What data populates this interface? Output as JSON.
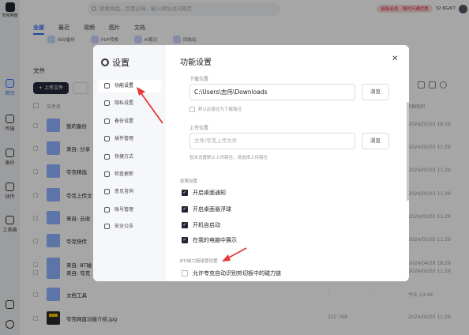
{
  "app": {
    "logo_text": "夸克网盘"
  },
  "search": {
    "placeholder": "搜索网盘、百度全网，输入网址访问网页"
  },
  "topbar": {
    "promo": "超级会员 · 限时开通优惠",
    "storage": "32.6G/67"
  },
  "rail": [
    {
      "label": "首页",
      "icon": "home-icon",
      "active": true
    },
    {
      "label": "传输",
      "icon": "transfer-icon"
    },
    {
      "label": "备份",
      "icon": "backup-icon"
    },
    {
      "label": "快传",
      "icon": "send-icon"
    },
    {
      "label": "工具箱",
      "icon": "toolbox-icon"
    }
  ],
  "tabs": [
    "全部",
    "最近",
    "视频",
    "图片",
    "文档"
  ],
  "quick": [
    "自动备份",
    "PDF转换",
    "AI笔记",
    "回收站"
  ],
  "files_title": "文件",
  "upload_label": "上传文件",
  "columns": {
    "name": "文件名",
    "modified": "修改时间"
  },
  "rows": [
    {
      "name": "我的备份",
      "size": "",
      "date": "2024/02/03 18:36"
    },
    {
      "name": "来自: 分享",
      "size": "",
      "date": "2024/02/03 11:29"
    },
    {
      "name": "夸克精选",
      "size": "",
      "date": "2024/02/03 11:29"
    },
    {
      "name": "夸克上传文",
      "size": "",
      "date": "2024/02/03 11:29"
    },
    {
      "name": "来自: 云收",
      "size": "",
      "date": "2024/02/03 11:29"
    },
    {
      "name": "夸克快传",
      "size": "",
      "date": "2024/02/03 11:29"
    },
    {
      "name": "来自: BT磁",
      "size": "",
      "date": "2024/04/28 16:29"
    },
    {
      "name": "来自: 夸克",
      "size": "",
      "date": "2024/02/03 11:29"
    },
    {
      "name": "文档工具",
      "size": "-",
      "date": "今天 13:44"
    },
    {
      "name": "夸克网盘功能介绍.jpg",
      "size": "322.7KB",
      "date": "2024/02/03 11:29"
    }
  ],
  "dialog": {
    "title": "设置",
    "section_title": "功能设置",
    "menu": [
      {
        "label": "功能设置",
        "icon": "sliders-icon",
        "active": true
      },
      {
        "label": "隐私设置",
        "icon": "shield-icon"
      },
      {
        "label": "备份设置",
        "icon": "backup-icon"
      },
      {
        "label": "插件管理",
        "icon": "plugin-icon"
      },
      {
        "label": "快捷方式",
        "icon": "shortcut-icon"
      },
      {
        "label": "检查更新",
        "icon": "update-icon"
      },
      {
        "label": "意见咨询",
        "icon": "feedback-icon"
      },
      {
        "label": "账号管理",
        "icon": "account-icon"
      },
      {
        "label": "安全公告",
        "icon": "notice-icon"
      }
    ],
    "download_label": "下载位置",
    "download_path": "C:\\Users\\志伟\\Downloads",
    "browse_label": "浏览",
    "default_download": "默认此路径为下载路径",
    "upload_label": "上传位置",
    "upload_placeholder": "文件/夸克上传文件",
    "upload_hint": "暂未设置默认上传路径，请选择上传路径",
    "permissions_label": "权限设置",
    "options": [
      {
        "label": "开启桌面通知",
        "checked": true
      },
      {
        "label": "开启桌面悬浮球",
        "checked": true
      },
      {
        "label": "开机自启动",
        "checked": true
      },
      {
        "label": "在我的电脑中展示",
        "checked": true
      }
    ],
    "bt_label": "BT/磁力链接管设置",
    "bt_option": "允许夸克自动识别剪切板中的磁力链",
    "bt_checked": false
  },
  "accent_color": "#3a6cf4",
  "arrow_color": "#e53935"
}
